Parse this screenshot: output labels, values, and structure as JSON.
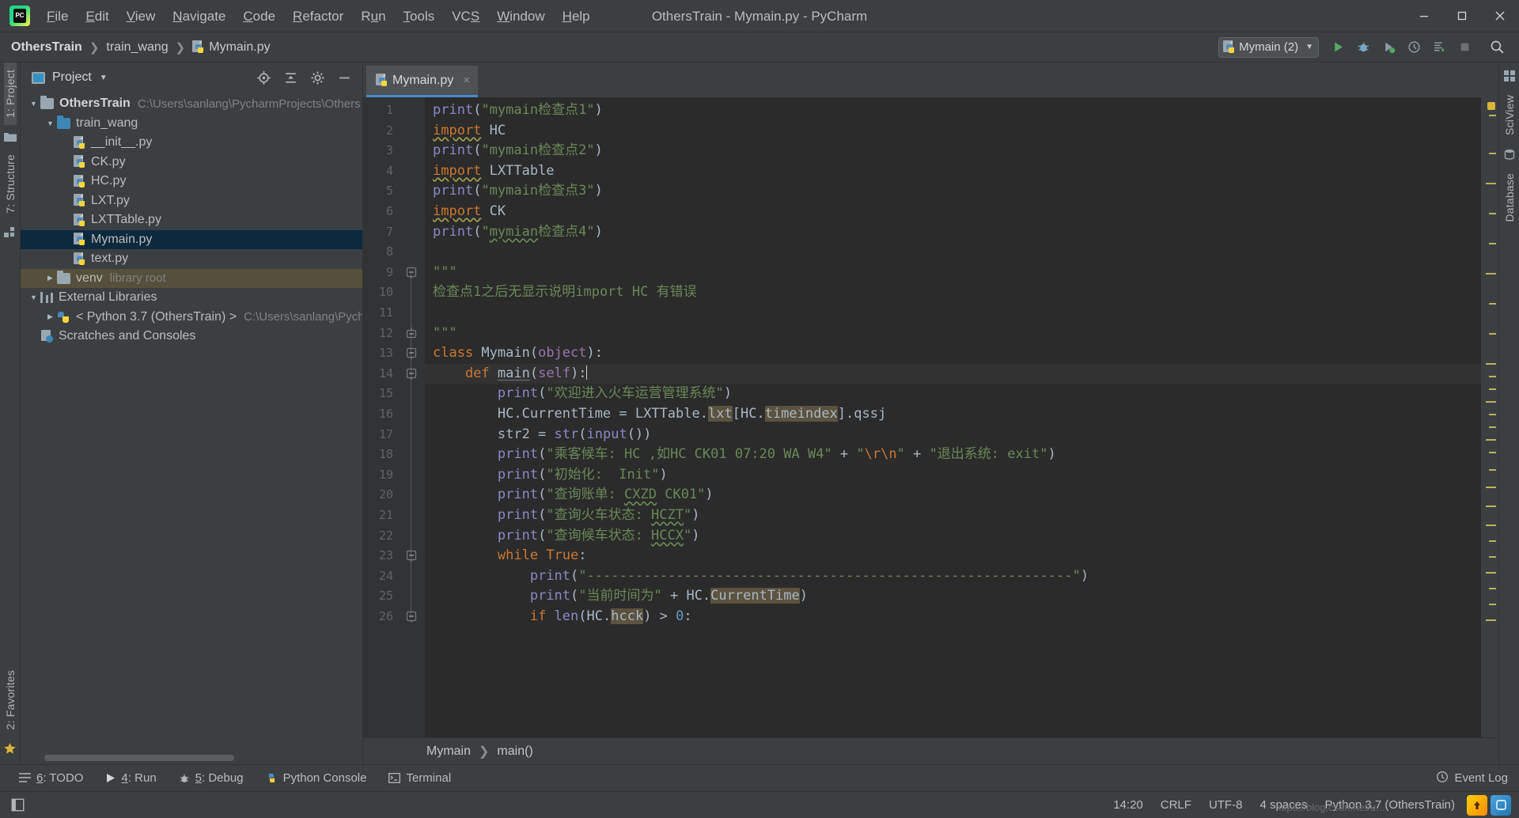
{
  "window": {
    "title": "OthersTrain - Mymain.py - PyCharm",
    "logo_label": "PC",
    "minimize_icon": "minimize-icon",
    "maximize_icon": "maximize-icon",
    "close_icon": "close-icon"
  },
  "menu": [
    {
      "label": "File",
      "mnemonic": "F"
    },
    {
      "label": "Edit",
      "mnemonic": "E"
    },
    {
      "label": "View",
      "mnemonic": "V"
    },
    {
      "label": "Navigate",
      "mnemonic": "N"
    },
    {
      "label": "Code",
      "mnemonic": "C"
    },
    {
      "label": "Refactor",
      "mnemonic": "R"
    },
    {
      "label": "Run",
      "mnemonic": "u"
    },
    {
      "label": "Tools",
      "mnemonic": "T"
    },
    {
      "label": "VCS",
      "mnemonic": "S"
    },
    {
      "label": "Window",
      "mnemonic": "W"
    },
    {
      "label": "Help",
      "mnemonic": "H"
    }
  ],
  "navbar": {
    "crumbs": [
      "OthersTrain",
      "train_wang",
      "Mymain.py"
    ],
    "run_config": "Mymain (2)",
    "buttons": [
      "run-icon",
      "debug-icon",
      "coverage-icon",
      "profile-icon",
      "run-with-console-icon",
      "stop-icon",
      "search-everywhere-icon"
    ]
  },
  "left_rail": {
    "top": [
      "1: Project"
    ],
    "bottom": [
      "2: Favorites"
    ],
    "structure": "7: Structure"
  },
  "right_rail": [
    "SciView",
    "Database"
  ],
  "project_panel": {
    "title": "Project",
    "toolbar": [
      "locate-icon",
      "collapse-all-icon",
      "settings-icon",
      "hide-icon"
    ],
    "tree": [
      {
        "label": "OthersTrain",
        "detail": "C:\\Users\\sanlang\\PycharmProjects\\Others",
        "type": "folder",
        "depth": 0,
        "arrow": "down",
        "bold": true,
        "state": "normal"
      },
      {
        "label": "train_wang",
        "detail": "",
        "type": "folder-blue",
        "depth": 1,
        "arrow": "down",
        "bold": false,
        "state": "normal"
      },
      {
        "label": "__init__.py",
        "detail": "",
        "type": "python",
        "depth": 2,
        "arrow": "none",
        "bold": false,
        "state": "normal"
      },
      {
        "label": "CK.py",
        "detail": "",
        "type": "python",
        "depth": 2,
        "arrow": "none",
        "bold": false,
        "state": "normal"
      },
      {
        "label": "HC.py",
        "detail": "",
        "type": "python",
        "depth": 2,
        "arrow": "none",
        "bold": false,
        "state": "normal"
      },
      {
        "label": "LXT.py",
        "detail": "",
        "type": "python",
        "depth": 2,
        "arrow": "none",
        "bold": false,
        "state": "normal"
      },
      {
        "label": "LXTTable.py",
        "detail": "",
        "type": "python",
        "depth": 2,
        "arrow": "none",
        "bold": false,
        "state": "normal"
      },
      {
        "label": "Mymain.py",
        "detail": "",
        "type": "python",
        "depth": 2,
        "arrow": "none",
        "bold": false,
        "state": "selected"
      },
      {
        "label": "text.py",
        "detail": "",
        "type": "python",
        "depth": 2,
        "arrow": "none",
        "bold": false,
        "state": "normal"
      },
      {
        "label": "venv",
        "detail": "library root",
        "type": "folder",
        "depth": 1,
        "arrow": "right",
        "bold": false,
        "state": "olive"
      },
      {
        "label": "External Libraries",
        "detail": "",
        "type": "libs",
        "depth": 0,
        "arrow": "down",
        "bold": false,
        "state": "normal"
      },
      {
        "label": "< Python 3.7 (OthersTrain) >",
        "detail": "C:\\Users\\sanlang\\Pych",
        "type": "interpreter",
        "depth": 1,
        "arrow": "right",
        "bold": false,
        "state": "normal"
      },
      {
        "label": "Scratches and Consoles",
        "detail": "",
        "type": "scratch",
        "depth": 0,
        "arrow": "none",
        "bold": false,
        "state": "normal"
      }
    ]
  },
  "editor": {
    "tab": {
      "label": "Mymain.py",
      "close": "×"
    },
    "caret_line": 14,
    "lines": [
      {
        "n": 1,
        "fold": "none",
        "tokens": [
          {
            "t": "print",
            "c": "bi"
          },
          {
            "t": "(",
            "c": "n"
          },
          {
            "t": "\"mymain检查点1\"",
            "c": "s"
          },
          {
            "t": ")",
            "c": "n"
          }
        ]
      },
      {
        "n": 2,
        "fold": "none",
        "tokens": [
          {
            "t": "import",
            "c": "k wavy"
          },
          {
            "t": " HC",
            "c": "n"
          }
        ]
      },
      {
        "n": 3,
        "fold": "none",
        "tokens": [
          {
            "t": "print",
            "c": "bi"
          },
          {
            "t": "(",
            "c": "n"
          },
          {
            "t": "\"mymain检查点2\"",
            "c": "s"
          },
          {
            "t": ")",
            "c": "n"
          }
        ]
      },
      {
        "n": 4,
        "fold": "none",
        "tokens": [
          {
            "t": "import",
            "c": "k wavy"
          },
          {
            "t": " LXTTable",
            "c": "n"
          }
        ]
      },
      {
        "n": 5,
        "fold": "none",
        "tokens": [
          {
            "t": "print",
            "c": "bi"
          },
          {
            "t": "(",
            "c": "n"
          },
          {
            "t": "\"mymain检查点3\"",
            "c": "s"
          },
          {
            "t": ")",
            "c": "n"
          }
        ]
      },
      {
        "n": 6,
        "fold": "none",
        "tokens": [
          {
            "t": "import",
            "c": "k wavy"
          },
          {
            "t": " CK",
            "c": "n"
          }
        ]
      },
      {
        "n": 7,
        "fold": "none",
        "tokens": [
          {
            "t": "print",
            "c": "bi"
          },
          {
            "t": "(",
            "c": "n"
          },
          {
            "t": "\"",
            "c": "s"
          },
          {
            "t": "mymian",
            "c": "s wavy-g"
          },
          {
            "t": "检查点4\"",
            "c": "s"
          },
          {
            "t": ")",
            "c": "n"
          }
        ]
      },
      {
        "n": 8,
        "fold": "none",
        "tokens": []
      },
      {
        "n": 9,
        "fold": "start",
        "tokens": [
          {
            "t": "\"\"\"",
            "c": "s"
          }
        ]
      },
      {
        "n": 10,
        "fold": "none",
        "tokens": [
          {
            "t": "检查点1之后无显示说明import HC 有错误",
            "c": "s"
          }
        ]
      },
      {
        "n": 11,
        "fold": "none",
        "tokens": []
      },
      {
        "n": 12,
        "fold": "end",
        "tokens": [
          {
            "t": "\"\"\"",
            "c": "s"
          }
        ]
      },
      {
        "n": 13,
        "fold": "start",
        "tokens": [
          {
            "t": "class",
            "c": "k"
          },
          {
            "t": " Mymain",
            "c": "n"
          },
          {
            "t": "(",
            "c": "n"
          },
          {
            "t": "object",
            "c": "pu"
          },
          {
            "t": "):",
            "c": "n"
          }
        ]
      },
      {
        "n": 14,
        "fold": "start",
        "tokens": [
          {
            "t": "    def",
            "c": "k"
          },
          {
            "t": " ",
            "c": "n"
          },
          {
            "t": "main",
            "c": "n ul"
          },
          {
            "t": "(",
            "c": "n"
          },
          {
            "t": "self",
            "c": "pu"
          },
          {
            "t": "):",
            "c": "n"
          }
        ]
      },
      {
        "n": 15,
        "fold": "none",
        "tokens": [
          {
            "t": "        ",
            "c": "n"
          },
          {
            "t": "print",
            "c": "bi"
          },
          {
            "t": "(",
            "c": "n"
          },
          {
            "t": "\"欢迎进入火车运营管理系统\"",
            "c": "s"
          },
          {
            "t": ")",
            "c": "n"
          }
        ]
      },
      {
        "n": 16,
        "fold": "none",
        "tokens": [
          {
            "t": "        HC.CurrentTime = LXTTable.",
            "c": "n"
          },
          {
            "t": "lxt",
            "c": "n hl"
          },
          {
            "t": "[HC.",
            "c": "n"
          },
          {
            "t": "timeindex",
            "c": "n hl"
          },
          {
            "t": "].qssj",
            "c": "n"
          }
        ]
      },
      {
        "n": 17,
        "fold": "none",
        "tokens": [
          {
            "t": "        str2 = ",
            "c": "n"
          },
          {
            "t": "str",
            "c": "bi"
          },
          {
            "t": "(",
            "c": "n"
          },
          {
            "t": "input",
            "c": "bi"
          },
          {
            "t": "())",
            "c": "n"
          }
        ]
      },
      {
        "n": 18,
        "fold": "none",
        "tokens": [
          {
            "t": "        ",
            "c": "n"
          },
          {
            "t": "print",
            "c": "bi"
          },
          {
            "t": "(",
            "c": "n"
          },
          {
            "t": "\"乘客候车: HC ,如HC CK01 07:20 WA W4\"",
            "c": "s"
          },
          {
            "t": " + ",
            "c": "n"
          },
          {
            "t": "\"",
            "c": "s"
          },
          {
            "t": "\\r\\n",
            "c": "esc"
          },
          {
            "t": "\"",
            "c": "s"
          },
          {
            "t": " + ",
            "c": "n"
          },
          {
            "t": "\"退出系统: exit\"",
            "c": "s"
          },
          {
            "t": ")",
            "c": "n"
          }
        ]
      },
      {
        "n": 19,
        "fold": "none",
        "tokens": [
          {
            "t": "        ",
            "c": "n"
          },
          {
            "t": "print",
            "c": "bi"
          },
          {
            "t": "(",
            "c": "n"
          },
          {
            "t": "\"初始化:  Init\"",
            "c": "s"
          },
          {
            "t": ")",
            "c": "n"
          }
        ]
      },
      {
        "n": 20,
        "fold": "none",
        "tokens": [
          {
            "t": "        ",
            "c": "n"
          },
          {
            "t": "print",
            "c": "bi"
          },
          {
            "t": "(",
            "c": "n"
          },
          {
            "t": "\"查询账单: ",
            "c": "s"
          },
          {
            "t": "CXZD",
            "c": "s wavy-g"
          },
          {
            "t": " CK01\"",
            "c": "s"
          },
          {
            "t": ")",
            "c": "n"
          }
        ]
      },
      {
        "n": 21,
        "fold": "none",
        "tokens": [
          {
            "t": "        ",
            "c": "n"
          },
          {
            "t": "print",
            "c": "bi"
          },
          {
            "t": "(",
            "c": "n"
          },
          {
            "t": "\"查询火车状态: ",
            "c": "s"
          },
          {
            "t": "HCZT",
            "c": "s wavy-g"
          },
          {
            "t": "\"",
            "c": "s"
          },
          {
            "t": ")",
            "c": "n"
          }
        ]
      },
      {
        "n": 22,
        "fold": "none",
        "tokens": [
          {
            "t": "        ",
            "c": "n"
          },
          {
            "t": "print",
            "c": "bi"
          },
          {
            "t": "(",
            "c": "n"
          },
          {
            "t": "\"查询候车状态: ",
            "c": "s"
          },
          {
            "t": "HCCX",
            "c": "s wavy-g"
          },
          {
            "t": "\"",
            "c": "s"
          },
          {
            "t": ")",
            "c": "n"
          }
        ]
      },
      {
        "n": 23,
        "fold": "start",
        "tokens": [
          {
            "t": "        ",
            "c": "n"
          },
          {
            "t": "while",
            "c": "k"
          },
          {
            "t": " ",
            "c": "n"
          },
          {
            "t": "True",
            "c": "k"
          },
          {
            "t": ":",
            "c": "n"
          }
        ]
      },
      {
        "n": 24,
        "fold": "none",
        "tokens": [
          {
            "t": "            ",
            "c": "n"
          },
          {
            "t": "print",
            "c": "bi"
          },
          {
            "t": "(",
            "c": "n"
          },
          {
            "t": "\"------------------------------------------------------------\"",
            "c": "s"
          },
          {
            "t": ")",
            "c": "n"
          }
        ]
      },
      {
        "n": 25,
        "fold": "none",
        "tokens": [
          {
            "t": "            ",
            "c": "n"
          },
          {
            "t": "print",
            "c": "bi"
          },
          {
            "t": "(",
            "c": "n"
          },
          {
            "t": "\"当前时间为\"",
            "c": "s"
          },
          {
            "t": " + HC.",
            "c": "n"
          },
          {
            "t": "CurrentTime",
            "c": "n hl"
          },
          {
            "t": ")",
            "c": "n"
          }
        ]
      },
      {
        "n": 26,
        "fold": "start",
        "tokens": [
          {
            "t": "            ",
            "c": "n"
          },
          {
            "t": "if",
            "c": "k"
          },
          {
            "t": " ",
            "c": "n"
          },
          {
            "t": "len",
            "c": "bi"
          },
          {
            "t": "(HC.",
            "c": "n"
          },
          {
            "t": "hcck",
            "c": "n hl"
          },
          {
            "t": ") > ",
            "c": "n"
          },
          {
            "t": "0",
            "c": "num"
          },
          {
            "t": ":",
            "c": "n"
          }
        ]
      }
    ],
    "breadcrumb": [
      "Mymain",
      "main()"
    ]
  },
  "bottom_toolbar": [
    {
      "label": "6: TODO",
      "mnemonic": "6",
      "icon": "todo-icon"
    },
    {
      "label": "4: Run",
      "mnemonic": "4",
      "icon": "run-icon"
    },
    {
      "label": "5: Debug",
      "mnemonic": "5",
      "icon": "debug-icon"
    },
    {
      "label": "Python Console",
      "mnemonic": "",
      "icon": "python-console-icon"
    },
    {
      "label": "Terminal",
      "mnemonic": "",
      "icon": "terminal-icon"
    }
  ],
  "event_log": {
    "label": "Event Log",
    "icon": "bell-icon"
  },
  "statusbar": {
    "time": "14:20",
    "line_sep": "CRLF",
    "encoding": "UTF-8",
    "indent": "4 spaces",
    "interpreter": "Python 3.7 (OthersTrain)",
    "watermark": "https://blog.csdn.net/u...",
    "badges": [
      "update-badge",
      "ide-badge"
    ]
  },
  "colors": {
    "accent": "#4a88c7",
    "selection": "#0d293e",
    "olive_row": "#55503c",
    "keyword": "#cc7832",
    "string": "#6a8759",
    "builtin": "#8888c6",
    "purple": "#9876aa",
    "editor_bg": "#2b2b2b",
    "chrome_bg": "#3c3f41"
  }
}
